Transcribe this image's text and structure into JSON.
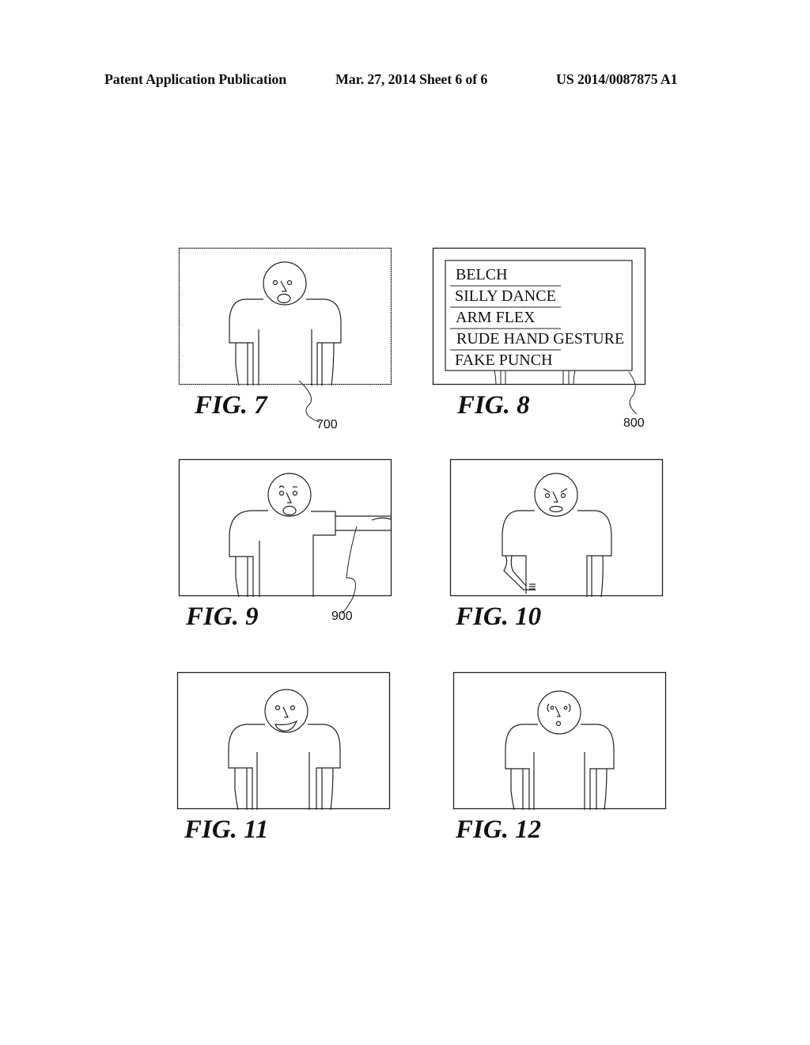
{
  "header": {
    "publication": "Patent Application Publication",
    "date_sheet": "Mar. 27, 2014  Sheet 6 of 6",
    "number": "US 2014/0087875 A1"
  },
  "figures": [
    {
      "caption": "FIG. 7",
      "ref": "700",
      "expression": "surprised"
    },
    {
      "caption": "FIG. 8",
      "ref": "800",
      "menu": [
        "BELCH",
        "SILLY DANCE",
        "ARM FLEX",
        "RUDE HAND GESTURE",
        "FAKE PUNCH"
      ]
    },
    {
      "caption": "FIG. 9",
      "ref": "900",
      "expression": "surprised, arm extended (fake punch)"
    },
    {
      "caption": "FIG. 10",
      "expression": "angry, arm flexed (rude hand gesture)"
    },
    {
      "caption": "FIG. 11",
      "expression": "smiling"
    },
    {
      "caption": "FIG. 12",
      "expression": "confused"
    }
  ]
}
